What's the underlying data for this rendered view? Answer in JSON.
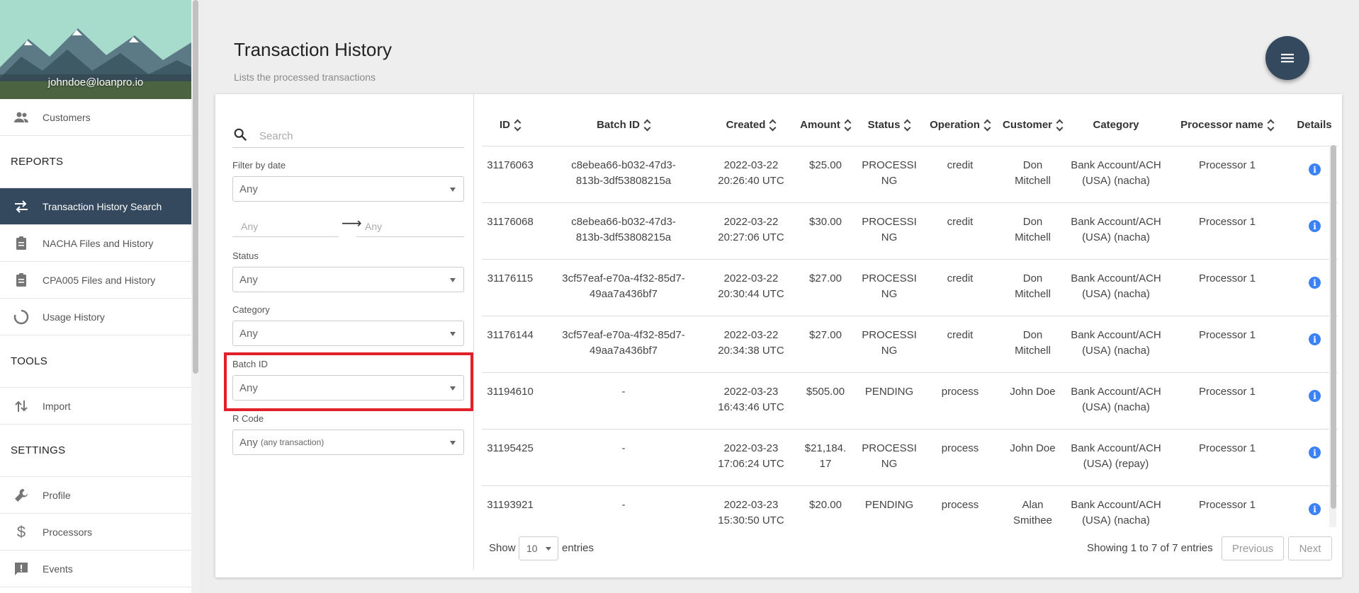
{
  "sidebar": {
    "email": "johndoe@loanpro.io",
    "customers": "Customers",
    "reports_heading": "REPORTS",
    "reports": [
      "Transaction History Search",
      "NACHA Files and History",
      "CPA005 Files and History",
      "Usage History"
    ],
    "tools_heading": "TOOLS",
    "tools": [
      "Import"
    ],
    "settings_heading": "SETTINGS",
    "settings": [
      "Profile",
      "Processors",
      "Events"
    ]
  },
  "header": {
    "title": "Transaction History",
    "subtitle": "Lists the processed transactions"
  },
  "filters": {
    "search_placeholder": "Search",
    "filter_by_date_label": "Filter by date",
    "filter_by_date_value": "Any",
    "date_from": "Any",
    "date_arrow": "⟶",
    "date_to": "Any",
    "status_label": "Status",
    "status_value": "Any",
    "category_label": "Category",
    "category_value": "Any",
    "batch_id_label": "Batch ID",
    "batch_id_value": "Any",
    "rcode_label": "R Code",
    "rcode_value": "Any",
    "rcode_hint": "(any transaction)"
  },
  "table": {
    "columns": [
      "ID",
      "Batch ID",
      "Created",
      "Amount",
      "Status",
      "Operation",
      "Customer",
      "Category",
      "Processor name",
      "Details"
    ],
    "rows": [
      {
        "id": "31176063",
        "batch_1": "c8ebea66-b032-47d3-",
        "batch_2": "813b-3df53808215a",
        "created_1": "2022-03-22",
        "created_2": "20:26:40 UTC",
        "amount_1": "$25.00",
        "amount_2": "",
        "status_1": "PROCESSI",
        "status_2": "NG",
        "operation": "credit",
        "customer_1": "Don",
        "customer_2": "Mitchell",
        "category_1": "Bank Account/ACH",
        "category_2": "(USA) (nacha)",
        "processor": "Processor 1"
      },
      {
        "id": "31176068",
        "batch_1": "c8ebea66-b032-47d3-",
        "batch_2": "813b-3df53808215a",
        "created_1": "2022-03-22",
        "created_2": "20:27:06 UTC",
        "amount_1": "$30.00",
        "amount_2": "",
        "status_1": "PROCESSI",
        "status_2": "NG",
        "operation": "credit",
        "customer_1": "Don",
        "customer_2": "Mitchell",
        "category_1": "Bank Account/ACH",
        "category_2": "(USA) (nacha)",
        "processor": "Processor 1"
      },
      {
        "id": "31176115",
        "batch_1": "3cf57eaf-e70a-4f32-85d7-",
        "batch_2": "49aa7a436bf7",
        "created_1": "2022-03-22",
        "created_2": "20:30:44 UTC",
        "amount_1": "$27.00",
        "amount_2": "",
        "status_1": "PROCESSI",
        "status_2": "NG",
        "operation": "credit",
        "customer_1": "Don",
        "customer_2": "Mitchell",
        "category_1": "Bank Account/ACH",
        "category_2": "(USA) (nacha)",
        "processor": "Processor 1"
      },
      {
        "id": "31176144",
        "batch_1": "3cf57eaf-e70a-4f32-85d7-",
        "batch_2": "49aa7a436bf7",
        "created_1": "2022-03-22",
        "created_2": "20:34:38 UTC",
        "amount_1": "$27.00",
        "amount_2": "",
        "status_1": "PROCESSI",
        "status_2": "NG",
        "operation": "credit",
        "customer_1": "Don",
        "customer_2": "Mitchell",
        "category_1": "Bank Account/ACH",
        "category_2": "(USA) (nacha)",
        "processor": "Processor 1"
      },
      {
        "id": "31194610",
        "batch_1": "-",
        "batch_2": "",
        "created_1": "2022-03-23",
        "created_2": "16:43:46 UTC",
        "amount_1": "$505.00",
        "amount_2": "",
        "status_1": "PENDING",
        "status_2": "",
        "operation": "process",
        "customer_1": "John Doe",
        "customer_2": "",
        "category_1": "Bank Account/ACH",
        "category_2": "(USA) (nacha)",
        "processor": "Processor 1"
      },
      {
        "id": "31195425",
        "batch_1": "-",
        "batch_2": "",
        "created_1": "2022-03-23",
        "created_2": "17:06:24 UTC",
        "amount_1": "$21,184.",
        "amount_2": "17",
        "status_1": "PROCESSI",
        "status_2": "NG",
        "operation": "process",
        "customer_1": "John Doe",
        "customer_2": "",
        "category_1": "Bank Account/ACH",
        "category_2": "(USA) (repay)",
        "processor": "Processor 1"
      },
      {
        "id": "31193921",
        "batch_1": "-",
        "batch_2": "",
        "created_1": "2022-03-23",
        "created_2": "15:30:50 UTC",
        "amount_1": "$20.00",
        "amount_2": "",
        "status_1": "PENDING",
        "status_2": "",
        "operation": "process",
        "customer_1": "Alan",
        "customer_2": "Smithee",
        "category_1": "Bank Account/ACH",
        "category_2": "(USA) (nacha)",
        "processor": "Processor 1"
      }
    ]
  },
  "footer": {
    "show_label": "Show",
    "page_length": "10",
    "entries_label": "entries",
    "info": "Showing 1 to 7 of 7 entries",
    "previous": "Previous",
    "next": "Next"
  },
  "colors": {
    "accent": "#34495e",
    "highlight": "#e2202b",
    "info": "#3b82f6"
  }
}
